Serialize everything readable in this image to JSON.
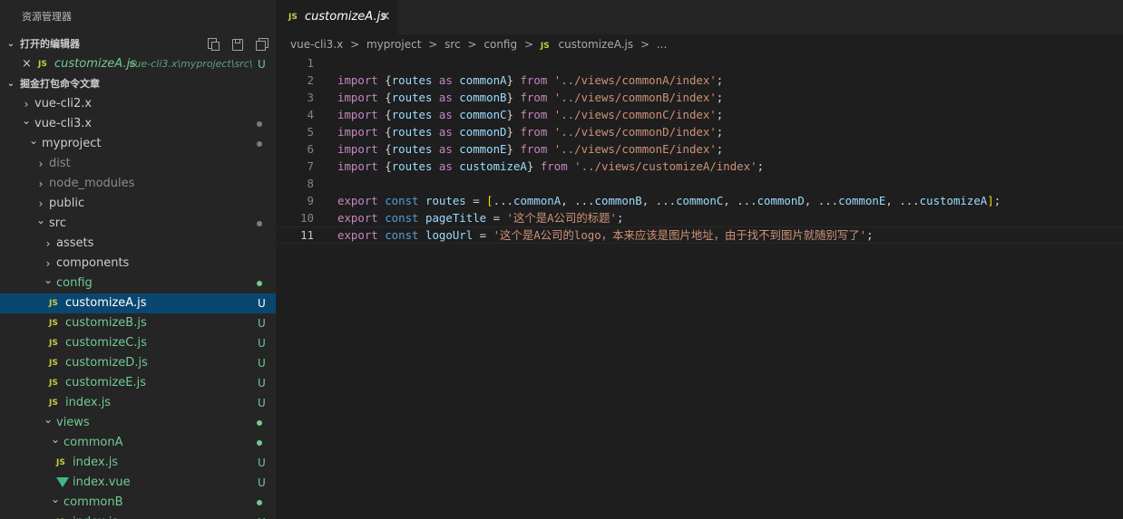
{
  "explorer": {
    "title": "资源管理器",
    "open_editors": {
      "label": "打开的编辑器",
      "item": {
        "close": "×",
        "icon": "JS",
        "name": "customizeA.js",
        "path": "vue-cli3.x\\myproject\\src\\...",
        "status": "U"
      }
    },
    "workspace": {
      "label": "掘金打包命令文章"
    },
    "tree": [
      {
        "label": "vue-cli2.x",
        "icon": "",
        "chevron": ">",
        "status": "",
        "dot": ""
      },
      {
        "label": "vue-cli3.x",
        "icon": "",
        "chevron": "v",
        "status": "",
        "dot": "#7d7d7d"
      },
      {
        "label": "myproject",
        "icon": "",
        "chevron": "v",
        "status": "",
        "dot": "#7d7d7d"
      },
      {
        "label": "dist",
        "icon": "",
        "chevron": ">",
        "status": "",
        "dot": ""
      },
      {
        "label": "node_modules",
        "icon": "",
        "chevron": ">",
        "status": "",
        "dot": ""
      },
      {
        "label": "public",
        "icon": "",
        "chevron": ">",
        "status": "",
        "dot": ""
      },
      {
        "label": "src",
        "icon": "",
        "chevron": "v",
        "status": "",
        "dot": "#7d7d7d"
      },
      {
        "label": "assets",
        "icon": "",
        "chevron": ">",
        "status": "",
        "dot": ""
      },
      {
        "label": "components",
        "icon": "",
        "chevron": ">",
        "status": "",
        "dot": ""
      },
      {
        "label": "config",
        "icon": "",
        "chevron": "v",
        "status": "",
        "dot": "#73c991"
      },
      {
        "label": "customizeA.js",
        "icon": "JS",
        "chevron": "",
        "status": "U",
        "dot": ""
      },
      {
        "label": "customizeB.js",
        "icon": "JS",
        "chevron": "",
        "status": "U",
        "dot": ""
      },
      {
        "label": "customizeC.js",
        "icon": "JS",
        "chevron": "",
        "status": "U",
        "dot": ""
      },
      {
        "label": "customizeD.js",
        "icon": "JS",
        "chevron": "",
        "status": "U",
        "dot": ""
      },
      {
        "label": "customizeE.js",
        "icon": "JS",
        "chevron": "",
        "status": "U",
        "dot": ""
      },
      {
        "label": "index.js",
        "icon": "JS",
        "chevron": "",
        "status": "U",
        "dot": ""
      },
      {
        "label": "views",
        "icon": "",
        "chevron": "v",
        "status": "",
        "dot": "#73c991"
      },
      {
        "label": "commonA",
        "icon": "",
        "chevron": "v",
        "status": "",
        "dot": "#73c991"
      },
      {
        "label": "index.js",
        "icon": "JS",
        "chevron": "",
        "status": "U",
        "dot": ""
      },
      {
        "label": "index.vue",
        "icon": "vue",
        "chevron": "",
        "status": "U",
        "dot": ""
      },
      {
        "label": "commonB",
        "icon": "",
        "chevron": "v",
        "status": "",
        "dot": "#73c991"
      },
      {
        "label": "index.js",
        "icon": "JS",
        "chevron": "",
        "status": "U",
        "dot": ""
      }
    ]
  },
  "tab": {
    "icon": "JS",
    "label": "customizeA.js",
    "close": "×"
  },
  "breadcrumb": {
    "items": [
      "vue-cli3.x",
      "myproject",
      "src",
      "config"
    ],
    "separator": ">",
    "file_icon": "JS",
    "file": "customizeA.js",
    "more": "..."
  },
  "editor": {
    "active_line": 11,
    "lines": [
      {
        "n": "1",
        "tokens": []
      },
      {
        "n": "2",
        "tokens": [
          [
            "kw",
            "import "
          ],
          [
            "pun",
            "{"
          ],
          [
            "var",
            "routes"
          ],
          [
            "kw",
            " as "
          ],
          [
            "var",
            "commonA"
          ],
          [
            "pun",
            "} "
          ],
          [
            "kw",
            "from "
          ],
          [
            "str",
            "'../views/commonA/index'"
          ],
          [
            "pun",
            ";"
          ]
        ]
      },
      {
        "n": "3",
        "tokens": [
          [
            "kw",
            "import "
          ],
          [
            "pun",
            "{"
          ],
          [
            "var",
            "routes"
          ],
          [
            "kw",
            " as "
          ],
          [
            "var",
            "commonB"
          ],
          [
            "pun",
            "} "
          ],
          [
            "kw",
            "from "
          ],
          [
            "str",
            "'../views/commonB/index'"
          ],
          [
            "pun",
            ";"
          ]
        ]
      },
      {
        "n": "4",
        "tokens": [
          [
            "kw",
            "import "
          ],
          [
            "pun",
            "{"
          ],
          [
            "var",
            "routes"
          ],
          [
            "kw",
            " as "
          ],
          [
            "var",
            "commonC"
          ],
          [
            "pun",
            "} "
          ],
          [
            "kw",
            "from "
          ],
          [
            "str",
            "'../views/commonC/index'"
          ],
          [
            "pun",
            ";"
          ]
        ]
      },
      {
        "n": "5",
        "tokens": [
          [
            "kw",
            "import "
          ],
          [
            "pun",
            "{"
          ],
          [
            "var",
            "routes"
          ],
          [
            "kw",
            " as "
          ],
          [
            "var",
            "commonD"
          ],
          [
            "pun",
            "} "
          ],
          [
            "kw",
            "from "
          ],
          [
            "str",
            "'../views/commonD/index'"
          ],
          [
            "pun",
            ";"
          ]
        ]
      },
      {
        "n": "6",
        "tokens": [
          [
            "kw",
            "import "
          ],
          [
            "pun",
            "{"
          ],
          [
            "var",
            "routes"
          ],
          [
            "kw",
            " as "
          ],
          [
            "var",
            "commonE"
          ],
          [
            "pun",
            "} "
          ],
          [
            "kw",
            "from "
          ],
          [
            "str",
            "'../views/commonE/index'"
          ],
          [
            "pun",
            ";"
          ]
        ]
      },
      {
        "n": "7",
        "tokens": [
          [
            "kw",
            "import "
          ],
          [
            "pun",
            "{"
          ],
          [
            "var",
            "routes"
          ],
          [
            "kw",
            " as "
          ],
          [
            "var",
            "customizeA"
          ],
          [
            "pun",
            "} "
          ],
          [
            "kw",
            "from "
          ],
          [
            "str",
            "'../views/customizeA/index'"
          ],
          [
            "pun",
            ";"
          ]
        ]
      },
      {
        "n": "8",
        "tokens": []
      },
      {
        "n": "9",
        "tokens": [
          [
            "kw",
            "export "
          ],
          [
            "st",
            "const "
          ],
          [
            "var",
            "routes"
          ],
          [
            "pun",
            " = "
          ],
          [
            "br",
            "["
          ],
          [
            "pun",
            "..."
          ],
          [
            "var",
            "commonA"
          ],
          [
            "pun",
            ", ..."
          ],
          [
            "var",
            "commonB"
          ],
          [
            "pun",
            ", ..."
          ],
          [
            "var",
            "commonC"
          ],
          [
            "pun",
            ", ..."
          ],
          [
            "var",
            "commonD"
          ],
          [
            "pun",
            ", ..."
          ],
          [
            "var",
            "commonE"
          ],
          [
            "pun",
            ", ..."
          ],
          [
            "var",
            "customizeA"
          ],
          [
            "br",
            "]"
          ],
          [
            "pun",
            ";"
          ]
        ]
      },
      {
        "n": "10",
        "tokens": [
          [
            "kw",
            "export "
          ],
          [
            "st",
            "const "
          ],
          [
            "var",
            "pageTitle"
          ],
          [
            "pun",
            " = "
          ],
          [
            "str",
            "'这个是A公司的标题'"
          ],
          [
            "pun",
            ";"
          ]
        ]
      },
      {
        "n": "11",
        "tokens": [
          [
            "kw",
            "export "
          ],
          [
            "st",
            "const "
          ],
          [
            "var",
            "logoUrl"
          ],
          [
            "pun",
            " = "
          ],
          [
            "str",
            "'这个是A公司的logo，本来应该是图片地址，由于找不到图片就随别写了'"
          ],
          [
            "pun",
            ";"
          ]
        ]
      }
    ]
  },
  "colors": {
    "sidebar_bg": "#252526",
    "editor_bg": "#1e1e1e",
    "selection": "#094771",
    "untracked": "#73c991",
    "js_icon": "#cbcb41",
    "vue_icon": "#41b883"
  }
}
